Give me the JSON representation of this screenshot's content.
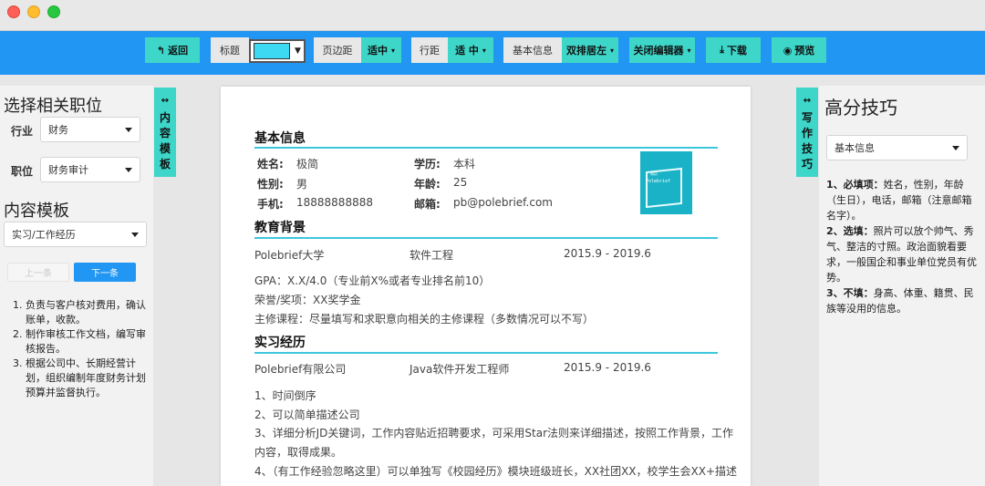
{
  "toolbar": {
    "back": "返回",
    "title_label": "标题",
    "title_color": "#3dd9f2",
    "margin_label": "页边距",
    "margin_value": "适中",
    "spacing_label": "行距",
    "spacing_value": "适 中",
    "basicinfo_label": "基本信息",
    "basicinfo_value": "双排居左",
    "close_editor": "关闭编辑器",
    "download": "下载",
    "preview": "预览"
  },
  "left_panel": {
    "heading": "选择相关职位",
    "industry_label": "行业",
    "industry_value": "财务",
    "position_label": "职位",
    "position_value": "财务审计",
    "template_heading": "内容模板",
    "template_value": "实习/工作经历",
    "prev": "上一条",
    "next": "下一条",
    "duties": [
      "负责与客户核对费用，确认账单，收款。",
      "制作审核工作文档，编写审核报告。",
      "根据公司中、长期经营计划，组织编制年度财务计划预算并监督执行。"
    ]
  },
  "content_tab": {
    "icon": "↔",
    "chars": [
      "内",
      "容",
      "模",
      "板"
    ]
  },
  "writing_tab": {
    "icon": "↔",
    "chars": [
      "写",
      "作",
      "技",
      "巧"
    ]
  },
  "resume": {
    "basic_title": "基本信息",
    "name_label": "姓名:",
    "name_value": "极简",
    "gender_label": "性别:",
    "gender_value": "男",
    "phone_label": "手机:",
    "phone_value": "18888888888",
    "edu_label": "学历:",
    "edu_value": "本科",
    "age_label": "年龄:",
    "age_value": "25",
    "email_label": "邮箱:",
    "email_value": "pb@polebrief.com",
    "photo_brand": "Polebrief",
    "photo_top": "简历",
    "education_title": "教育背景",
    "edu_school": "Polebrief大学",
    "edu_major": "软件工程",
    "edu_period": "2015.9 - 2019.6",
    "gpa": "GPA：X.X/4.0（专业前X%或者专业排名前10）",
    "honors": "荣誉/奖项：XX奖学金",
    "courses": "主修课程：尽量填写和求职意向相关的主修课程（多数情况可以不写）",
    "intern_title": "实习经历",
    "intern_company": "Polebrief有限公司",
    "intern_role": "Java软件开发工程师",
    "intern_period": "2015.9 - 2019.6",
    "intern_items": [
      "1、时间倒序",
      "2、可以简单描述公司",
      "3、详细分析JD关键词，工作内容贴近招聘要求，可采用Star法则来详细描述，按照工作背景，工作",
      "内容，取得成果。",
      "4、（有工作经验忽略这里）可以单独写《校园经历》模块班级班长，XX社团XX，校学生会XX+描述"
    ]
  },
  "right_panel": {
    "heading": "高分技巧",
    "select_value": "基本信息",
    "tip1_head": "1、必填项：",
    "tip1_body": "姓名，性别，年龄（生日），电话，邮箱（注意邮箱名字）。",
    "tip2_head": "2、选填：",
    "tip2_body": "照片可以放个帅气、秀气、整洁的寸照。政治面貌看要求，一般国企和事业单位党员有优势。",
    "tip3_head": "3、不填：",
    "tip3_body": "身高、体重、籍贯、民族等没用的信息。"
  }
}
